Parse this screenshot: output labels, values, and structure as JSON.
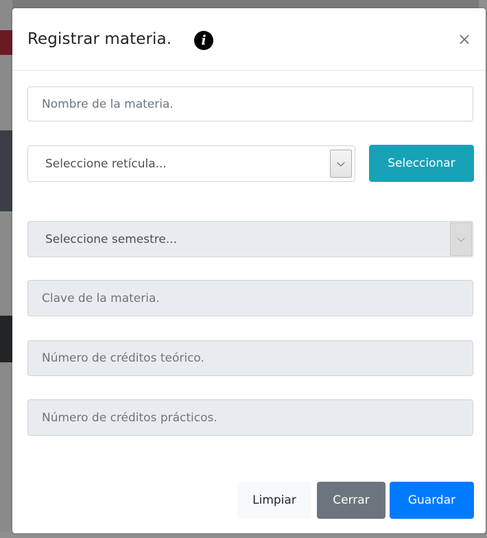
{
  "modal": {
    "title": "Registrar materia.",
    "info_icon": "info-circle-icon",
    "close_label": "×"
  },
  "form": {
    "nombre_placeholder": "Nombre de la materia.",
    "reticula_selected": "Seleccione retícula...",
    "seleccionar_label": "Seleccionar",
    "semestre_selected": "Seleccione semestre...",
    "clave_placeholder": "Clave de la materia.",
    "creditos_teoricos_placeholder": "Número de créditos teórico.",
    "creditos_practicos_placeholder": "Número de créditos prácticos."
  },
  "footer": {
    "limpiar_label": "Limpiar",
    "cerrar_label": "Cerrar",
    "guardar_label": "Guardar"
  },
  "colors": {
    "info": "#17a2b8",
    "secondary": "#6c757d",
    "primary": "#007bff",
    "light": "#f8f9fa",
    "disabled_bg": "#e9ecef"
  }
}
